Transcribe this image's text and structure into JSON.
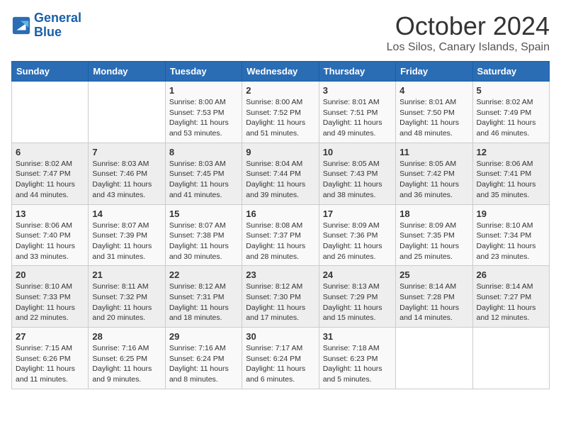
{
  "header": {
    "logo_line1": "General",
    "logo_line2": "Blue",
    "title": "October 2024",
    "subtitle": "Los Silos, Canary Islands, Spain"
  },
  "days_of_week": [
    "Sunday",
    "Monday",
    "Tuesday",
    "Wednesday",
    "Thursday",
    "Friday",
    "Saturday"
  ],
  "weeks": [
    [
      {
        "day": "",
        "detail": ""
      },
      {
        "day": "",
        "detail": ""
      },
      {
        "day": "1",
        "detail": "Sunrise: 8:00 AM\nSunset: 7:53 PM\nDaylight: 11 hours and 53 minutes."
      },
      {
        "day": "2",
        "detail": "Sunrise: 8:00 AM\nSunset: 7:52 PM\nDaylight: 11 hours and 51 minutes."
      },
      {
        "day": "3",
        "detail": "Sunrise: 8:01 AM\nSunset: 7:51 PM\nDaylight: 11 hours and 49 minutes."
      },
      {
        "day": "4",
        "detail": "Sunrise: 8:01 AM\nSunset: 7:50 PM\nDaylight: 11 hours and 48 minutes."
      },
      {
        "day": "5",
        "detail": "Sunrise: 8:02 AM\nSunset: 7:49 PM\nDaylight: 11 hours and 46 minutes."
      }
    ],
    [
      {
        "day": "6",
        "detail": "Sunrise: 8:02 AM\nSunset: 7:47 PM\nDaylight: 11 hours and 44 minutes."
      },
      {
        "day": "7",
        "detail": "Sunrise: 8:03 AM\nSunset: 7:46 PM\nDaylight: 11 hours and 43 minutes."
      },
      {
        "day": "8",
        "detail": "Sunrise: 8:03 AM\nSunset: 7:45 PM\nDaylight: 11 hours and 41 minutes."
      },
      {
        "day": "9",
        "detail": "Sunrise: 8:04 AM\nSunset: 7:44 PM\nDaylight: 11 hours and 39 minutes."
      },
      {
        "day": "10",
        "detail": "Sunrise: 8:05 AM\nSunset: 7:43 PM\nDaylight: 11 hours and 38 minutes."
      },
      {
        "day": "11",
        "detail": "Sunrise: 8:05 AM\nSunset: 7:42 PM\nDaylight: 11 hours and 36 minutes."
      },
      {
        "day": "12",
        "detail": "Sunrise: 8:06 AM\nSunset: 7:41 PM\nDaylight: 11 hours and 35 minutes."
      }
    ],
    [
      {
        "day": "13",
        "detail": "Sunrise: 8:06 AM\nSunset: 7:40 PM\nDaylight: 11 hours and 33 minutes."
      },
      {
        "day": "14",
        "detail": "Sunrise: 8:07 AM\nSunset: 7:39 PM\nDaylight: 11 hours and 31 minutes."
      },
      {
        "day": "15",
        "detail": "Sunrise: 8:07 AM\nSunset: 7:38 PM\nDaylight: 11 hours and 30 minutes."
      },
      {
        "day": "16",
        "detail": "Sunrise: 8:08 AM\nSunset: 7:37 PM\nDaylight: 11 hours and 28 minutes."
      },
      {
        "day": "17",
        "detail": "Sunrise: 8:09 AM\nSunset: 7:36 PM\nDaylight: 11 hours and 26 minutes."
      },
      {
        "day": "18",
        "detail": "Sunrise: 8:09 AM\nSunset: 7:35 PM\nDaylight: 11 hours and 25 minutes."
      },
      {
        "day": "19",
        "detail": "Sunrise: 8:10 AM\nSunset: 7:34 PM\nDaylight: 11 hours and 23 minutes."
      }
    ],
    [
      {
        "day": "20",
        "detail": "Sunrise: 8:10 AM\nSunset: 7:33 PM\nDaylight: 11 hours and 22 minutes."
      },
      {
        "day": "21",
        "detail": "Sunrise: 8:11 AM\nSunset: 7:32 PM\nDaylight: 11 hours and 20 minutes."
      },
      {
        "day": "22",
        "detail": "Sunrise: 8:12 AM\nSunset: 7:31 PM\nDaylight: 11 hours and 18 minutes."
      },
      {
        "day": "23",
        "detail": "Sunrise: 8:12 AM\nSunset: 7:30 PM\nDaylight: 11 hours and 17 minutes."
      },
      {
        "day": "24",
        "detail": "Sunrise: 8:13 AM\nSunset: 7:29 PM\nDaylight: 11 hours and 15 minutes."
      },
      {
        "day": "25",
        "detail": "Sunrise: 8:14 AM\nSunset: 7:28 PM\nDaylight: 11 hours and 14 minutes."
      },
      {
        "day": "26",
        "detail": "Sunrise: 8:14 AM\nSunset: 7:27 PM\nDaylight: 11 hours and 12 minutes."
      }
    ],
    [
      {
        "day": "27",
        "detail": "Sunrise: 7:15 AM\nSunset: 6:26 PM\nDaylight: 11 hours and 11 minutes."
      },
      {
        "day": "28",
        "detail": "Sunrise: 7:16 AM\nSunset: 6:25 PM\nDaylight: 11 hours and 9 minutes."
      },
      {
        "day": "29",
        "detail": "Sunrise: 7:16 AM\nSunset: 6:24 PM\nDaylight: 11 hours and 8 minutes."
      },
      {
        "day": "30",
        "detail": "Sunrise: 7:17 AM\nSunset: 6:24 PM\nDaylight: 11 hours and 6 minutes."
      },
      {
        "day": "31",
        "detail": "Sunrise: 7:18 AM\nSunset: 6:23 PM\nDaylight: 11 hours and 5 minutes."
      },
      {
        "day": "",
        "detail": ""
      },
      {
        "day": "",
        "detail": ""
      }
    ]
  ]
}
